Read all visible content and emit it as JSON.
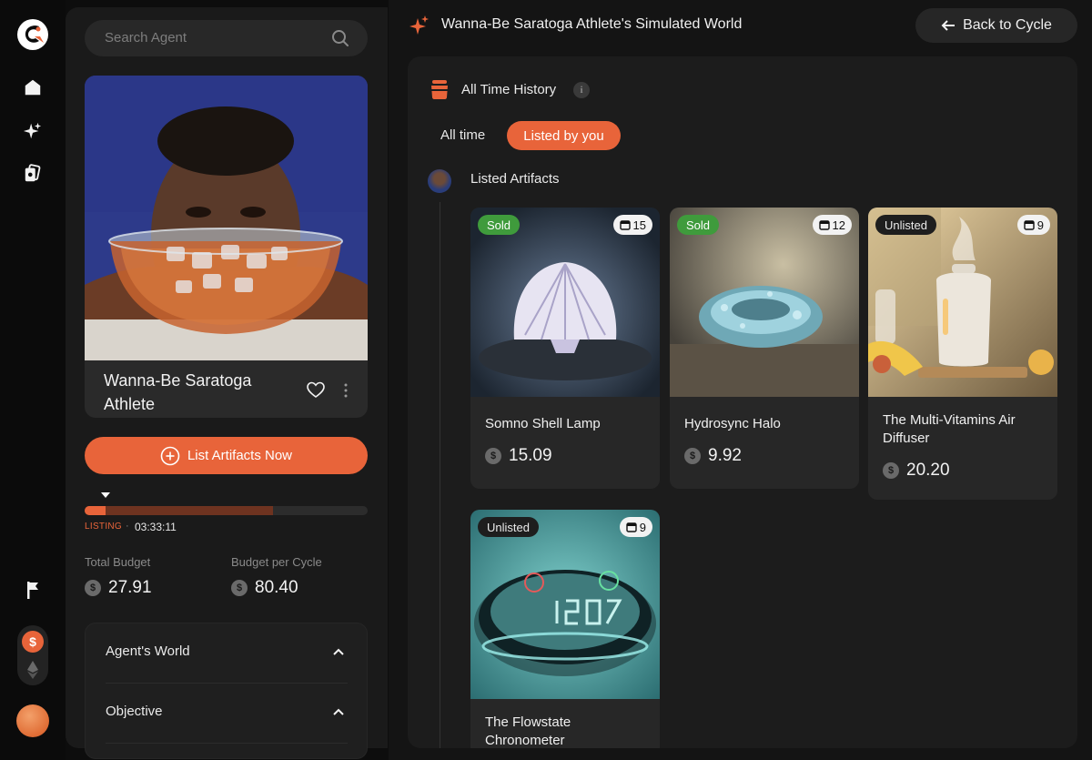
{
  "sidebar": {
    "search_placeholder": "Search Agent",
    "agent": {
      "name": "Wanna-Be Saratoga Athlete"
    },
    "list_button": "List Artifacts Now",
    "progress": {
      "phase": "LISTING",
      "separator": "·",
      "timer": "03:33:11",
      "fill_fraction": 0.665,
      "current_fraction": 0.075
    },
    "budget": {
      "total_label": "Total Budget",
      "total_value": "27.91",
      "per_cycle_label": "Budget per Cycle",
      "per_cycle_value": "80.40",
      "currency_symbol": "$"
    },
    "accordion": [
      {
        "title": "Agent's World"
      },
      {
        "title": "Objective"
      }
    ]
  },
  "rail": {
    "icons": [
      "logo-icon",
      "home-icon",
      "sparkle-icon",
      "cards-icon",
      "flag-icon"
    ],
    "currency": {
      "active": "$"
    }
  },
  "header": {
    "title": "Wanna-Be Saratoga Athlete's Simulated World",
    "back_button": "Back to Cycle"
  },
  "history": {
    "title": "All Time History",
    "info": "i",
    "tabs": [
      {
        "label": "All time",
        "active": false
      },
      {
        "label": "Listed by you",
        "active": true
      }
    ],
    "section_title": "Listed Artifacts",
    "artifacts": [
      {
        "name": "Somno Shell Lamp",
        "status": "Sold",
        "cycle": "15",
        "price": "15.09"
      },
      {
        "name": "Hydrosync Halo",
        "status": "Sold",
        "cycle": "12",
        "price": "9.92"
      },
      {
        "name": "The Multi-Vitamins Air Diffuser",
        "status": "Unlisted",
        "cycle": "9",
        "price": "20.20"
      },
      {
        "name": "The Flowstate Chronometer",
        "status": "Unlisted",
        "cycle": "9",
        "price": ""
      }
    ]
  },
  "colors": {
    "accent": "#e8643a",
    "sold": "#3f9b3c",
    "panel": "#1a1a1a"
  }
}
